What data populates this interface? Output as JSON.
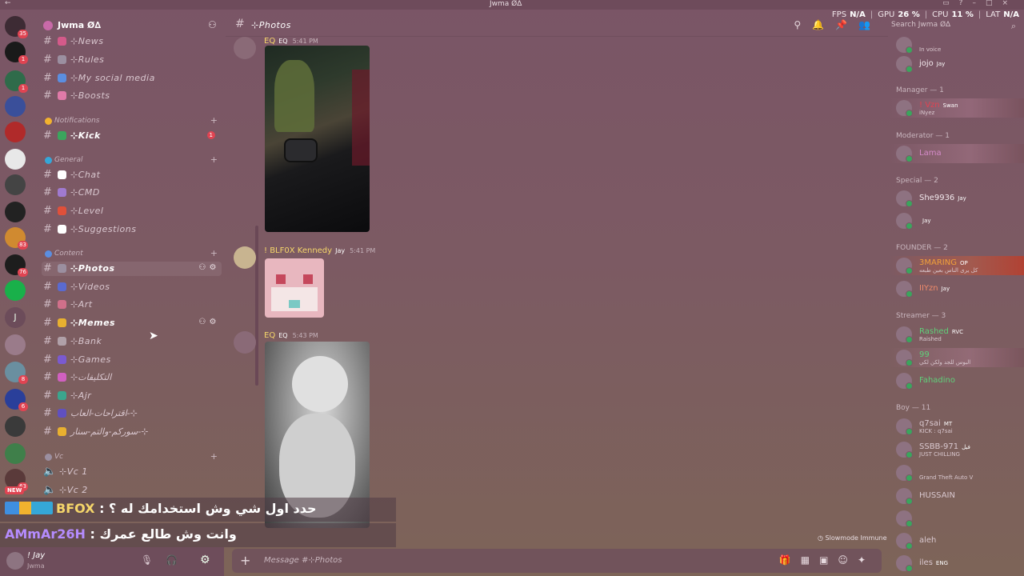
{
  "window": {
    "title": "Jwma Ø∆"
  },
  "perf": {
    "fps_label": "FPS",
    "fps": "N/A",
    "gpu_label": "GPU",
    "gpu": "26 %",
    "cpu_label": "CPU",
    "cpu": "11 %",
    "lat_label": "LAT",
    "lat": "N/A"
  },
  "rail": {
    "badges": [
      "35",
      "1",
      "1",
      "83",
      "76",
      "J",
      "8",
      "6",
      "63"
    ],
    "new_label": "NEW"
  },
  "guild": {
    "name": "Jwma Ø∆"
  },
  "channels_top": [
    {
      "name": "⊹News",
      "icon_color": "#d45a8a"
    },
    {
      "name": "⊹Rules",
      "icon_color": "#9b8fa0"
    },
    {
      "name": "⊹My social media",
      "icon_color": "#5b8ee0"
    },
    {
      "name": "⊹Boosts",
      "icon_color": "#e07aa8"
    }
  ],
  "cat_notifications": {
    "name": "Notifications"
  },
  "chan_kick": {
    "name": "⊹Kick",
    "unread": "1",
    "icon_color": "#3ba55d"
  },
  "cat_general": {
    "name": "General"
  },
  "channels_general": [
    {
      "name": "⊹Chat",
      "icon_color": "#ffffff"
    },
    {
      "name": "⊹CMD",
      "icon_color": "#a07ad0"
    },
    {
      "name": "⊹Level",
      "icon_color": "#e0503a"
    },
    {
      "name": "⊹Suggestions",
      "icon_color": "#ffffff"
    }
  ],
  "cat_content": {
    "name": "Content"
  },
  "channels_content": [
    {
      "name": "⊹Photos",
      "icon_color": "#9b8fa0",
      "active": true
    },
    {
      "name": "⊹Videos",
      "icon_color": "#5a6ad0"
    },
    {
      "name": "⊹Art",
      "icon_color": "#d0708a"
    },
    {
      "name": "⊹Memes",
      "icon_color": "#e8b030"
    },
    {
      "name": "⊹Bank",
      "icon_color": "#b0a0a8"
    },
    {
      "name": "⊹Games",
      "icon_color": "#7a5ad0"
    },
    {
      "name": "⊹التكليفات",
      "icon_color": "#d060c0"
    },
    {
      "name": "⊹Ajr",
      "icon_color": "#3ba58d"
    },
    {
      "name": "اقتراحات-العاب-⊹",
      "icon_color": "#6050c0"
    },
    {
      "name": "سوركم-والتم-سنار-⊹",
      "icon_color": "#e8b030"
    }
  ],
  "cat_vc": {
    "name": "Vc"
  },
  "voice": [
    {
      "name": "⊹Vc 1"
    },
    {
      "name": "⊹Vc 2"
    }
  ],
  "user": {
    "name": "! Jay",
    "sub": "Jwma"
  },
  "header": {
    "channel": "⊹Photos"
  },
  "search": {
    "placeholder": "Search Jwma Ø∆"
  },
  "messages": [
    {
      "author": "EQ",
      "tag": "EQ",
      "time": "5:41 PM"
    },
    {
      "author": "! BLF0X Kennedy",
      "tag": "Jay",
      "time": "5:41 PM"
    },
    {
      "author": "EQ",
      "tag": "EQ",
      "time": "5:43 PM"
    }
  ],
  "slowmode": "Slowmode Immune",
  "composer": {
    "placeholder": "Message #⊹Photos"
  },
  "overlay": {
    "line1_name": "BFOX",
    "line1_text": "حدد اول شي وش استخدامك له ؟",
    "line2_name": "AMmAr26H",
    "line2_text": "وانت وش طالع عمرك"
  },
  "members": {
    "top": [
      {
        "name": "",
        "sub": "In voice"
      },
      {
        "name": "jojo",
        "tag": "Jay"
      }
    ],
    "manager": {
      "title": "Manager — 1",
      "items": [
        {
          "name": "! Vzn",
          "tag": "Swan",
          "sub": "iNyez",
          "color": "#e04452"
        }
      ]
    },
    "moderator": {
      "title": "Moderator — 1",
      "items": [
        {
          "name": "Lama",
          "color": "#d48ac8"
        }
      ]
    },
    "special": {
      "title": "Special — 2",
      "items": [
        {
          "name": "She9936",
          "tag": "Jay",
          "color": "#f2e8ec"
        },
        {
          "name": "",
          "tag": "Jay",
          "color": "#f2e8ec"
        }
      ]
    },
    "founder": {
      "title": "FOUNDER — 2",
      "items": [
        {
          "name": "3MARING",
          "tag": "OP",
          "sub": "كل يرى الناس بعين طبعه",
          "color": "#f2a03a"
        },
        {
          "name": "IIYzn",
          "tag": "Jay",
          "color": "#f08a6a"
        }
      ]
    },
    "streamer": {
      "title": "Streamer — 3",
      "items": [
        {
          "name": "Rashed",
          "tag": "RVC",
          "sub": "Raished",
          "color": "#5fd07a"
        },
        {
          "name": "99",
          "sub": "البوس للجد ولكن لكي",
          "color": "#5fd07a"
        },
        {
          "name": "Fahadino",
          "color": "#5fd07a"
        }
      ]
    },
    "boy": {
      "title": "Boy — 11",
      "items": [
        {
          "name": "q7sai",
          "tag": "MT",
          "sub": "KICK : q7sai",
          "color": "#d9c8cf"
        },
        {
          "name": "SSBB-971",
          "tag": "فيل",
          "sub": "JUST CHILLING",
          "color": "#d9c8cf"
        },
        {
          "name": "",
          "sub": "Grand Theft Auto V",
          "color": "#d9c8cf"
        },
        {
          "name": "HUSSAIN",
          "color": "#d9c8cf"
        },
        {
          "name": "",
          "color": "#d9c8cf"
        },
        {
          "name": "aleh",
          "color": "#d9c8cf"
        },
        {
          "name": "iles",
          "tag": "ENG",
          "color": "#d9c8cf"
        }
      ]
    }
  },
  "colors": {
    "accent": "#f5d66a",
    "unread": "#e04452",
    "online": "#3ba55d"
  }
}
